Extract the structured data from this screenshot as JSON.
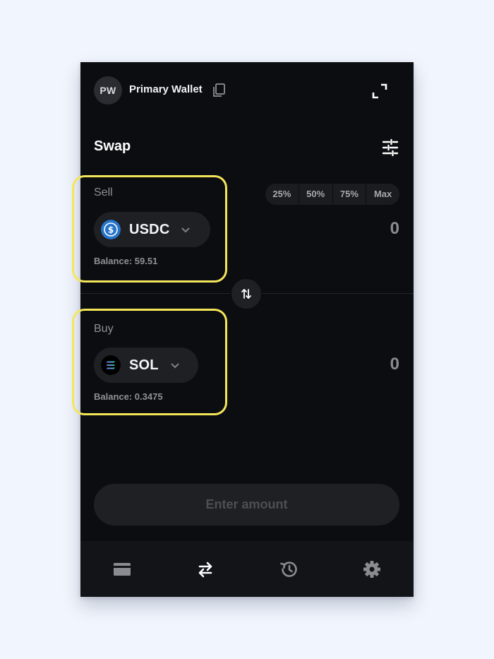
{
  "header": {
    "avatar_initials": "PW",
    "wallet_name": "Primary Wallet",
    "copy_icon": "copy-icon",
    "expand_icon": "expand-icon"
  },
  "title": "Swap",
  "settings_icon": "sliders-icon",
  "sell": {
    "label": "Sell",
    "token": "USDC",
    "token_icon": "usdc-icon",
    "amount": "0",
    "balance": "Balance: 59.51",
    "percent_options": [
      "25%",
      "50%",
      "75%",
      "Max"
    ]
  },
  "buy": {
    "label": "Buy",
    "token": "SOL",
    "token_icon": "sol-icon",
    "amount": "0",
    "balance": "Balance: 0.3475"
  },
  "cta_label": "Enter amount",
  "nav": [
    {
      "name": "wallet",
      "icon": "wallet-icon"
    },
    {
      "name": "swap",
      "icon": "swap-icon",
      "active": true
    },
    {
      "name": "history",
      "icon": "history-icon"
    },
    {
      "name": "settings",
      "icon": "gear-icon"
    }
  ],
  "colors": {
    "panel_bg": "#0c0d10",
    "highlight": "#f4e65a",
    "usdc_blue": "#2775ca",
    "muted_text": "#8e9096"
  }
}
